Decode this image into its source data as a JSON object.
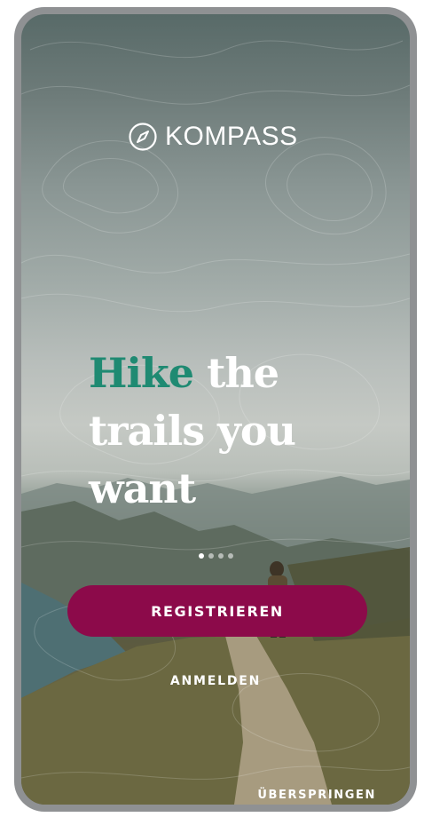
{
  "app": {
    "brand_name": "KOMPASS",
    "logo_icon": "compass-icon"
  },
  "headline": {
    "accent_word": "Hike",
    "rest_line1": " the",
    "line2": "trails you",
    "line3": "want"
  },
  "carousel": {
    "page_count": 4,
    "active_index": 0
  },
  "actions": {
    "register_label": "REGISTRIEREN",
    "login_label": "ANMELDEN",
    "skip_label": "ÜBERSPRINGEN"
  },
  "colors": {
    "accent_green": "#1f8a72",
    "button_primary": "#8c0a4a",
    "text_on_dark": "#ffffff",
    "device_frame": "#8f9193"
  }
}
